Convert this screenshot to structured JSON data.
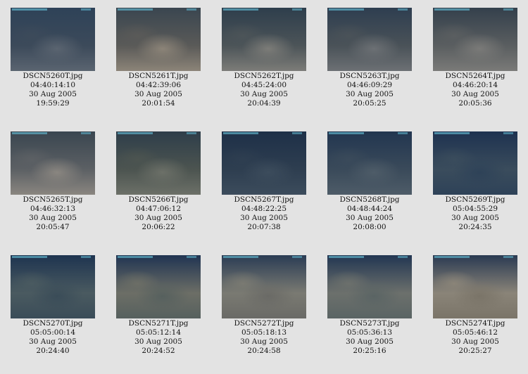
{
  "gallery": {
    "items": [
      {
        "file": "DSCN5260T.jpg",
        "timecode": "04:40:14:10",
        "date": "30 Aug 2005",
        "time": "19:59:29",
        "colors": [
          "#2e4258",
          "#5a6470",
          "#3c4a5a"
        ]
      },
      {
        "file": "DSCN5261T.jpg",
        "timecode": "04:42:39:06",
        "date": "30 Aug 2005",
        "time": "20:01:54",
        "colors": [
          "#3a4650",
          "#8c8478",
          "#5a5a58"
        ]
      },
      {
        "file": "DSCN5262T.jpg",
        "timecode": "04:45:24:00",
        "date": "30 Aug 2005",
        "time": "20:04:39",
        "colors": [
          "#2e3e4c",
          "#7c7c78",
          "#4c5458"
        ]
      },
      {
        "file": "DSCN5263T.jpg",
        "timecode": "04:46:09:29",
        "date": "30 Aug 2005",
        "time": "20:05:25",
        "colors": [
          "#2e3e50",
          "#6c7074",
          "#4a5258"
        ]
      },
      {
        "file": "DSCN5264T.jpg",
        "timecode": "04:46:20:14",
        "date": "30 Aug 2005",
        "time": "20:05:36",
        "colors": [
          "#34404c",
          "#7a7a78",
          "#5a5e60"
        ]
      },
      {
        "file": "DSCN5265T.jpg",
        "timecode": "04:46:32:13",
        "date": "30 Aug 2005",
        "time": "20:05:47",
        "colors": [
          "#3a4650",
          "#8a8680",
          "#5c6064"
        ]
      },
      {
        "file": "DSCN5266T.jpg",
        "timecode": "04:47:06:12",
        "date": "30 Aug 2005",
        "time": "20:06:22",
        "colors": [
          "#2e3e4a",
          "#6c7068",
          "#4c5450"
        ]
      },
      {
        "file": "DSCN5267T.jpg",
        "timecode": "04:48:22:25",
        "date": "30 Aug 2005",
        "time": "20:07:38",
        "colors": [
          "#1e3048",
          "#3c4c5c",
          "#2e3e50"
        ]
      },
      {
        "file": "DSCN5268T.jpg",
        "timecode": "04:48:44:24",
        "date": "30 Aug 2005",
        "time": "20:08:00",
        "colors": [
          "#223650",
          "#4e5c68",
          "#3a4a5a"
        ]
      },
      {
        "file": "DSCN5269T.jpg",
        "timecode": "05:04:55:29",
        "date": "30 Aug 2005",
        "time": "20:24:35",
        "colors": [
          "#1e3250",
          "#2e4258",
          "#3a4c5c"
        ]
      },
      {
        "file": "DSCN5270T.jpg",
        "timecode": "05:05:00:14",
        "date": "30 Aug 2005",
        "time": "20:24:40",
        "colors": [
          "#1e3450",
          "#3a4c58",
          "#4a5a60"
        ]
      },
      {
        "file": "DSCN5271T.jpg",
        "timecode": "05:05:12:14",
        "date": "30 Aug 2005",
        "time": "20:24:52",
        "colors": [
          "#203452",
          "#56605e",
          "#6c6e66"
        ]
      },
      {
        "file": "DSCN5272T.jpg",
        "timecode": "05:05:18:13",
        "date": "30 Aug 2005",
        "time": "20:24:58",
        "colors": [
          "#2a3c54",
          "#6a6a66",
          "#7a7a72"
        ]
      },
      {
        "file": "DSCN5273T.jpg",
        "timecode": "05:05:36:13",
        "date": "30 Aug 2005",
        "time": "20:25:16",
        "colors": [
          "#223652",
          "#5a6464",
          "#6c706c"
        ]
      },
      {
        "file": "DSCN5274T.jpg",
        "timecode": "05:05:46:12",
        "date": "30 Aug 2005",
        "time": "20:25:27",
        "colors": [
          "#2a3a52",
          "#7a7468",
          "#8a8478"
        ]
      }
    ]
  }
}
